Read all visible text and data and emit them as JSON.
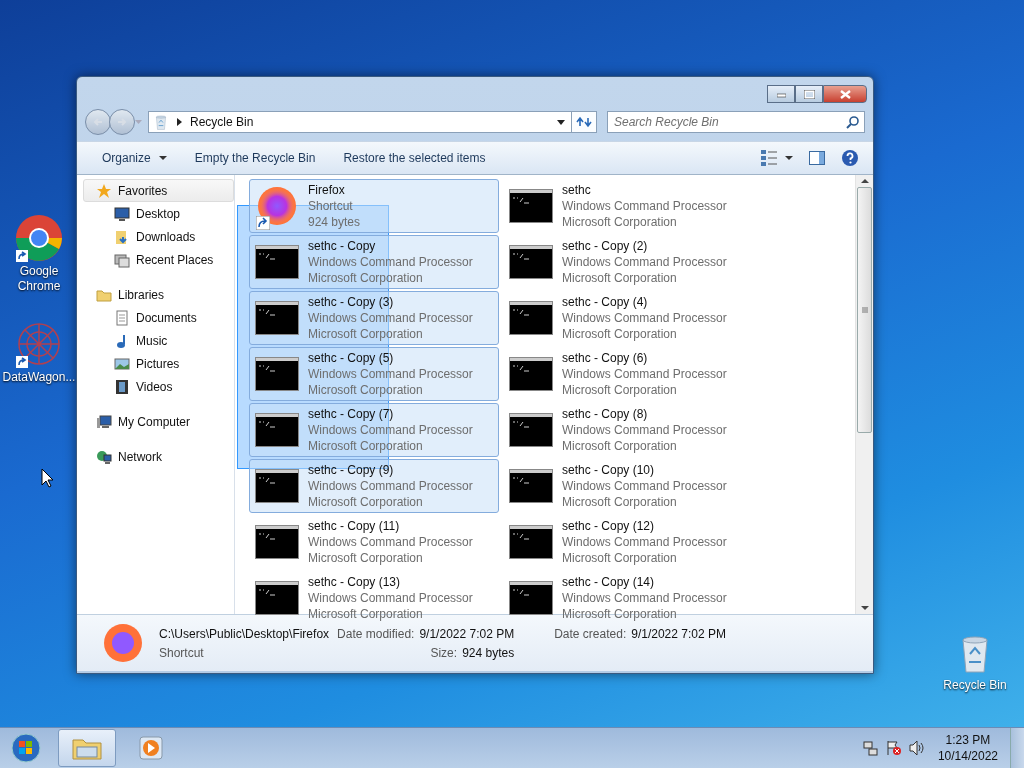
{
  "desktop_icons": [
    {
      "kind": "chrome",
      "label": "Google Chrome"
    },
    {
      "kind": "datawagon",
      "label": "DataWagon..."
    },
    {
      "kind": "recycle",
      "label": "Recycle Bin"
    }
  ],
  "window": {
    "address": "Recycle Bin",
    "search": {
      "placeholder": "Search Recycle Bin"
    },
    "toolbar": [
      {
        "label": "Organize",
        "dropdown": true
      },
      {
        "label": "Empty the Recycle Bin",
        "dropdown": false
      },
      {
        "label": "Restore the selected items",
        "dropdown": false
      }
    ],
    "sidebar": [
      {
        "label": "Favorites",
        "selected": true,
        "children": [
          {
            "label": "Desktop",
            "selected": false
          },
          {
            "label": "Downloads",
            "selected": false
          },
          {
            "label": "Recent Places",
            "selected": false
          }
        ]
      },
      {
        "label": "Libraries",
        "selected": false,
        "children": [
          {
            "label": "Documents",
            "selected": false
          },
          {
            "label": "Music",
            "selected": false
          },
          {
            "label": "Pictures",
            "selected": false
          },
          {
            "label": "Videos",
            "selected": false
          }
        ]
      },
      {
        "label": "My Computer",
        "selected": false
      },
      {
        "label": "Network",
        "selected": false
      }
    ],
    "items": [
      {
        "kind": "shortcut",
        "name": "Firefox",
        "line2": "Shortcut",
        "line3": "924 bytes",
        "selected": true
      },
      {
        "kind": "cmd",
        "name": "sethc",
        "line2": "Windows Command Processor",
        "line3": "Microsoft Corporation",
        "selected": false
      },
      {
        "kind": "cmd",
        "name": "sethc - Copy",
        "line2": "Windows Command Processor",
        "line3": "Microsoft Corporation",
        "selected": true
      },
      {
        "kind": "cmd",
        "name": "sethc - Copy (2)",
        "line2": "Windows Command Processor",
        "line3": "Microsoft Corporation",
        "selected": false
      },
      {
        "kind": "cmd",
        "name": "sethc - Copy (3)",
        "line2": "Windows Command Processor",
        "line3": "Microsoft Corporation",
        "selected": true
      },
      {
        "kind": "cmd",
        "name": "sethc - Copy (4)",
        "line2": "Windows Command Processor",
        "line3": "Microsoft Corporation",
        "selected": false
      },
      {
        "kind": "cmd",
        "name": "sethc - Copy (5)",
        "line2": "Windows Command Processor",
        "line3": "Microsoft Corporation",
        "selected": true
      },
      {
        "kind": "cmd",
        "name": "sethc - Copy (6)",
        "line2": "Windows Command Processor",
        "line3": "Microsoft Corporation",
        "selected": false
      },
      {
        "kind": "cmd",
        "name": "sethc - Copy (7)",
        "line2": "Windows Command Processor",
        "line3": "Microsoft Corporation",
        "selected": true
      },
      {
        "kind": "cmd",
        "name": "sethc - Copy (8)",
        "line2": "Windows Command Processor",
        "line3": "Microsoft Corporation",
        "selected": false
      },
      {
        "kind": "cmd",
        "name": "sethc - Copy (9)",
        "line2": "Windows Command Processor",
        "line3": "Microsoft Corporation",
        "selected": true
      },
      {
        "kind": "cmd",
        "name": "sethc - Copy (10)",
        "line2": "Windows Command Processor",
        "line3": "Microsoft Corporation",
        "selected": false
      },
      {
        "kind": "cmd",
        "name": "sethc - Copy (11)",
        "line2": "Windows Command Processor",
        "line3": "Microsoft Corporation",
        "selected": false
      },
      {
        "kind": "cmd",
        "name": "sethc - Copy (12)",
        "line2": "Windows Command Processor",
        "line3": "Microsoft Corporation",
        "selected": false
      },
      {
        "kind": "cmd",
        "name": "sethc - Copy (13)",
        "line2": "Windows Command Processor",
        "line3": "Microsoft Corporation",
        "selected": false
      },
      {
        "kind": "cmd",
        "name": "sethc - Copy (14)",
        "line2": "Windows Command Processor",
        "line3": "Microsoft Corporation",
        "selected": false
      }
    ],
    "details": {
      "path": "C:\\Users\\Public\\Desktop\\Firefox",
      "type": "Shortcut",
      "fields": [
        {
          "label": "Date modified:",
          "value": "9/1/2022 7:02 PM"
        },
        {
          "label": "Size:",
          "value": "924 bytes"
        },
        {
          "label": "Date created:",
          "value": "9/1/2022 7:02 PM"
        }
      ]
    }
  },
  "taskbar": {
    "apps": [
      {
        "kind": "explorer",
        "active": true
      },
      {
        "kind": "media",
        "active": false
      }
    ],
    "time": "1:23 PM",
    "date": "10/14/2022"
  }
}
